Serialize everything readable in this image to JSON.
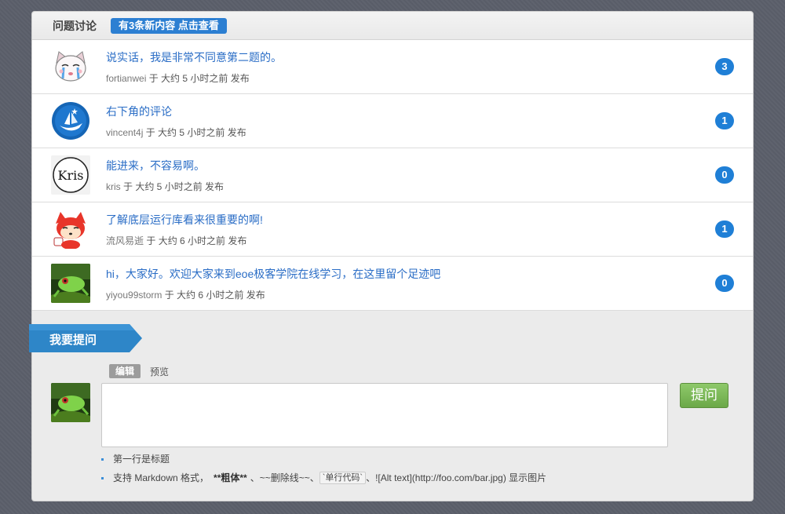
{
  "header": {
    "title": "问题讨论",
    "new_badge": "有3条新内容 点击查看"
  },
  "discussions": [
    {
      "title": "说实话，我是非常不同意第二题的。",
      "author": "fortianwei",
      "meta": "于 大约 5 小时之前 发布",
      "count": "3",
      "avatar_icon": "cat-avatar-icon"
    },
    {
      "title": "右下角的评论",
      "author": "vincent4j",
      "meta": "于 大约 5 小时之前 发布",
      "count": "1",
      "avatar_icon": "ship-avatar-icon"
    },
    {
      "title": "能进来，不容易啊。",
      "author": "kris",
      "meta": "于 大约 5 小时之前 发布",
      "count": "0",
      "avatar_icon": "kris-avatar-icon",
      "avatar_text": "Kris"
    },
    {
      "title": "了解底层运行库看来很重要的啊!",
      "author": "流风易逝",
      "meta": "于 大约 6 小时之前 发布",
      "count": "1",
      "avatar_icon": "fox-avatar-icon"
    },
    {
      "title": "hi，大家好。欢迎大家来到eoe极客学院在线学习，在这里留个足迹吧",
      "author": "yiyou99storm",
      "meta": "于 大约 6 小时之前 发布",
      "count": "0",
      "avatar_icon": "frog-avatar-icon"
    }
  ],
  "compose": {
    "ribbon_label": "我要提问",
    "tab_edit": "编辑",
    "tab_preview": "预览",
    "submit_label": "提问",
    "textarea_value": "",
    "hints": {
      "line1": "第一行是标题",
      "line2_a": "支持 Markdown 格式，",
      "line2_bold": "**粗体**",
      "line2_b": "、~~删除线~~、",
      "line2_code": "`单行代码`",
      "line2_c": "、![Alt text](http://foo.com/bar.jpg) 显示图片"
    }
  },
  "colors": {
    "accent_blue": "#1f7fd6",
    "link_blue": "#2a6dc6",
    "ask_green": "#7cb957",
    "ribbon_blue": "#2e86c8"
  }
}
